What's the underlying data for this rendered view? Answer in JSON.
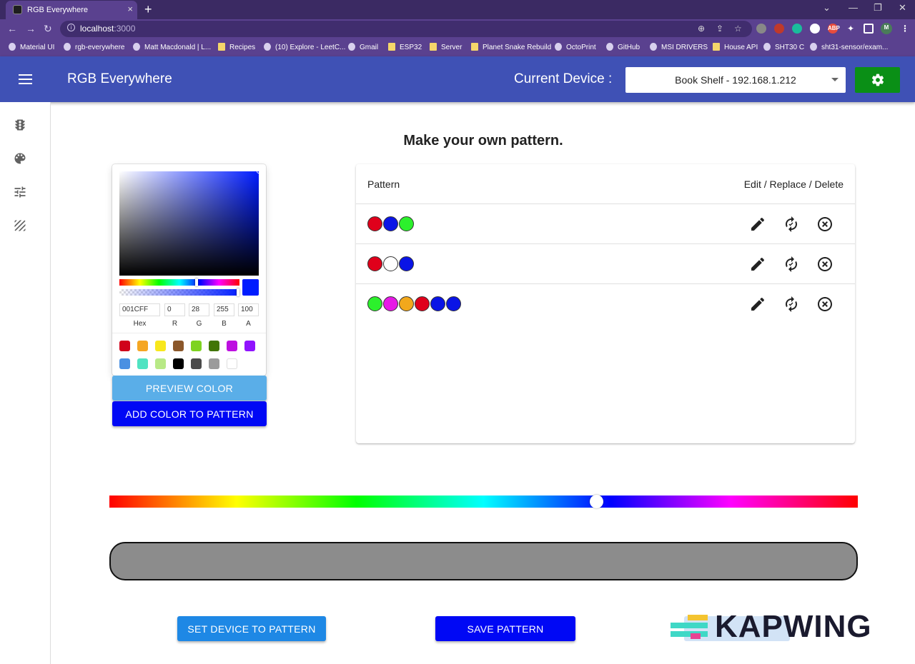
{
  "browser": {
    "tab_title": "RGB Everywhere",
    "tab_close": "×",
    "new_tab": "+",
    "url_host": "localhost",
    "url_port": ":3000",
    "window_controls": [
      "⌄",
      "—",
      "❐",
      "✕"
    ]
  },
  "bookmarks": [
    {
      "label": "Material UI",
      "icon": "mui-icon"
    },
    {
      "label": "rgb-everywhere",
      "icon": "github-icon"
    },
    {
      "label": "Matt Macdonald | L...",
      "icon": "linkedin-icon"
    },
    {
      "label": "Recipes",
      "icon": "folder-icon"
    },
    {
      "label": "(10) Explore - LeetC...",
      "icon": "leetcode-icon"
    },
    {
      "label": "Gmail",
      "icon": "gmail-icon"
    },
    {
      "label": "ESP32",
      "icon": "folder-icon"
    },
    {
      "label": "Server",
      "icon": "folder-icon"
    },
    {
      "label": "Planet Snake Rebuild",
      "icon": "folder-icon"
    },
    {
      "label": "OctoPrint",
      "icon": "octoprint-icon"
    },
    {
      "label": "GitHub",
      "icon": "github-icon"
    },
    {
      "label": "MSI DRIVERS",
      "icon": "msi-icon"
    },
    {
      "label": "House API",
      "icon": "folder-icon"
    },
    {
      "label": "SHT30 C",
      "icon": "page-icon"
    },
    {
      "label": "sht31-sensor/exam...",
      "icon": "github-icon"
    }
  ],
  "appbar": {
    "title": "RGB Everywhere",
    "device_label": "Current Device :",
    "device_value": "Book Shelf - 192.168.1.212",
    "settings_icon": "gear-icon"
  },
  "sidebar_icons": [
    "traffic-light-icon",
    "palette-icon",
    "tune-icon",
    "texture-icon"
  ],
  "page": {
    "heading": "Make your own pattern."
  },
  "picker": {
    "current_color": "#001cff",
    "hex": "001CFF",
    "r": "0",
    "g": "28",
    "b": "255",
    "a": "100",
    "labels": {
      "hex": "Hex",
      "r": "R",
      "g": "G",
      "b": "B",
      "a": "A"
    },
    "hue_fraction": 0.645,
    "alpha_fraction": 1.0,
    "presets": [
      "#d0021b",
      "#f5a623",
      "#f8e71c",
      "#8b572a",
      "#7ed321",
      "#417505",
      "#bd10e0",
      "#9013fe",
      "#4a90e2",
      "#50e3c2",
      "#b8e986",
      "#000000",
      "#4a4a4a",
      "#9b9b9b",
      "#ffffff"
    ]
  },
  "buttons": {
    "preview_color": "PREVIEW COLOR",
    "add_color": "ADD COLOR TO PATTERN",
    "set_device": "SET DEVICE TO PATTERN",
    "save_pattern": "SAVE PATTERN"
  },
  "table": {
    "col_pattern": "Pattern",
    "col_actions": "Edit / Replace / Delete",
    "rows": [
      {
        "colors": [
          "#e0001b",
          "#0a14e6",
          "#2cf02c"
        ]
      },
      {
        "colors": [
          "#e0001b",
          "#ffffff",
          "#0a14e6"
        ]
      },
      {
        "colors": [
          "#2cf02c",
          "#e619e6",
          "#f2a81c",
          "#e0001b",
          "#0a14e6",
          "#0a14e6"
        ]
      }
    ]
  },
  "hue_slider": {
    "fraction": 0.65
  },
  "preview_bar_color": "#8c8c8c",
  "watermark": {
    "text": "KAPWING"
  }
}
